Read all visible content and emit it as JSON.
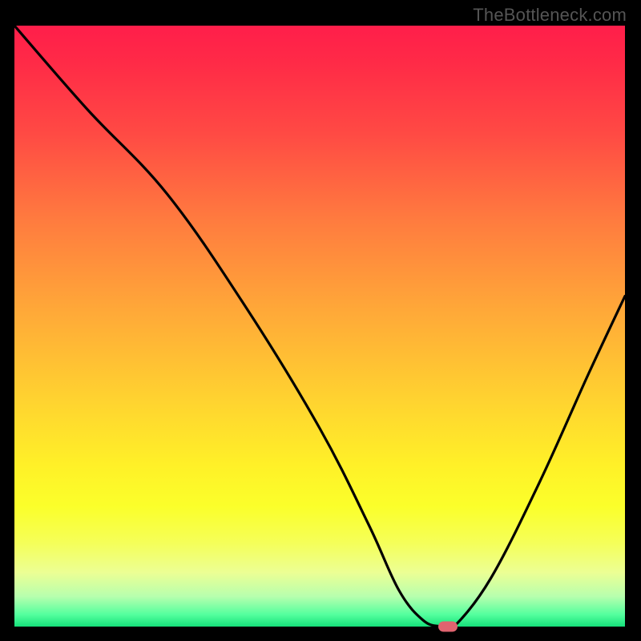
{
  "watermark": "TheBottleneck.com",
  "chart_data": {
    "type": "line",
    "title": "",
    "xlabel": "",
    "ylabel": "",
    "xlim": [
      0,
      100
    ],
    "ylim": [
      0,
      100
    ],
    "grid": false,
    "legend": false,
    "background_gradient": {
      "top": "#ff1e4a",
      "mid": "#ffd230",
      "bottom": "#16e07a"
    },
    "series": [
      {
        "name": "bottleneck-curve",
        "color": "#000000",
        "x": [
          0,
          12,
          25,
          38,
          50,
          58,
          63,
          67,
          70,
          72,
          78,
          86,
          94,
          100
        ],
        "values": [
          100,
          86,
          72,
          53,
          33,
          17,
          6,
          1,
          0,
          0,
          8,
          24,
          42,
          55
        ]
      }
    ],
    "marker": {
      "x": 71,
      "y": 0,
      "color": "#e0636f",
      "shape": "pill"
    }
  }
}
